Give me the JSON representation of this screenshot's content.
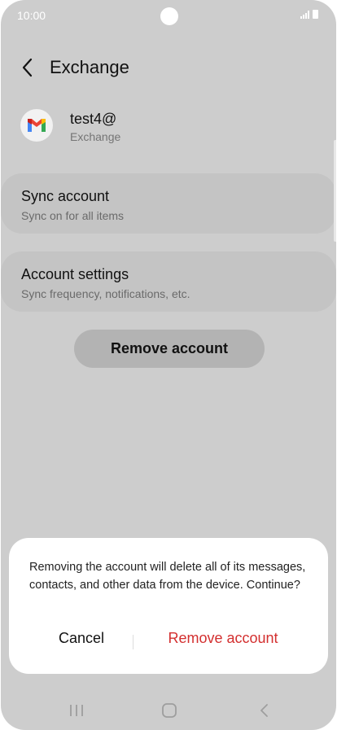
{
  "status_bar": {
    "time": "10:00"
  },
  "header": {
    "title": "Exchange"
  },
  "account": {
    "name": "test4@",
    "type": "Exchange",
    "icon": "gmail-icon"
  },
  "cards": [
    {
      "title": "Sync account",
      "subtitle": "Sync on for all items"
    },
    {
      "title": "Account settings",
      "subtitle": "Sync frequency, notifications, etc."
    }
  ],
  "remove_button_label": "Remove account",
  "dialog": {
    "message": "Removing the account will delete all of its messages, contacts, and other data from the device. Continue?",
    "cancel_label": "Cancel",
    "confirm_label": "Remove account",
    "confirm_color": "#d32f2f"
  },
  "nav_bar": {
    "icons": [
      "recent-apps-icon",
      "home-icon",
      "back-icon"
    ]
  }
}
